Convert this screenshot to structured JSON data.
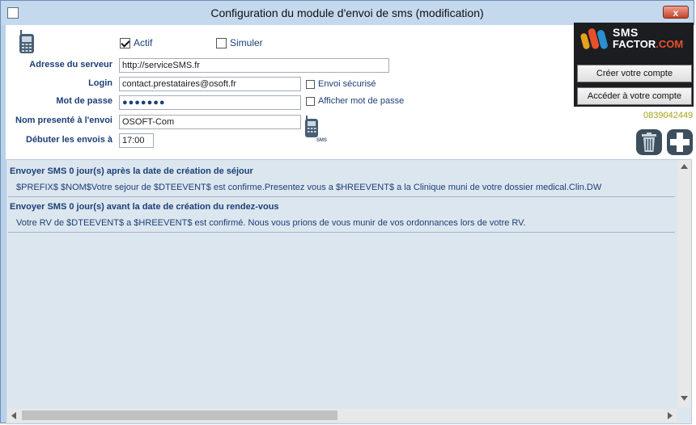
{
  "window": {
    "title": "Configuration du module d'envoi de sms (modification)",
    "close_label": "x"
  },
  "form": {
    "actif_label": "Actif",
    "actif_checked": true,
    "simuler_label": "Simuler",
    "simuler_checked": false,
    "server_label": "Adresse du serveur",
    "server_value": "http://serviceSMS.fr",
    "login_label": "Login",
    "login_value": "contact.prestataires@osoft.fr",
    "secure_label": "Envoi sécurisé",
    "password_label": "Mot de passe",
    "password_mask": "●●●●●●●",
    "show_password_label": "Afficher mot de passe",
    "sender_label": "Nom presenté à l'envoi",
    "sender_value": "OSOFT-Com",
    "start_label": "Débuter les envois à",
    "start_value": "17:00"
  },
  "icons": {
    "phone_small_text": "SMS"
  },
  "logo": {
    "sms": "SMS",
    "factor": "FACTOR",
    "com": ".COM"
  },
  "account": {
    "create_label": "Créer votre compte",
    "access_label": "Accéder à votre compte",
    "phone_number": "0839042449"
  },
  "rules": [
    {
      "title": "Envoyer SMS 0 jour(s) après la date de création de séjour",
      "message": "$PREFIX$ $NOM$Votre sejour de $DTEEVENT$ est confirme.Presentez vous a $HREEVENT$ a la Clinique muni de votre dossier medical.Clin.DW"
    },
    {
      "title": "Envoyer SMS 0 jour(s) avant la date de création du rendez-vous",
      "message": "Votre RV de $DTEEVENT$ a  $HREEVENT$ est confirmé. Nous vous prions de vous munir de vos ordonnances lors de votre RV."
    }
  ],
  "colors": {
    "label_blue": "#1c3f78",
    "phone_number": "#a8a21c",
    "list_background": "#dce6ef"
  }
}
